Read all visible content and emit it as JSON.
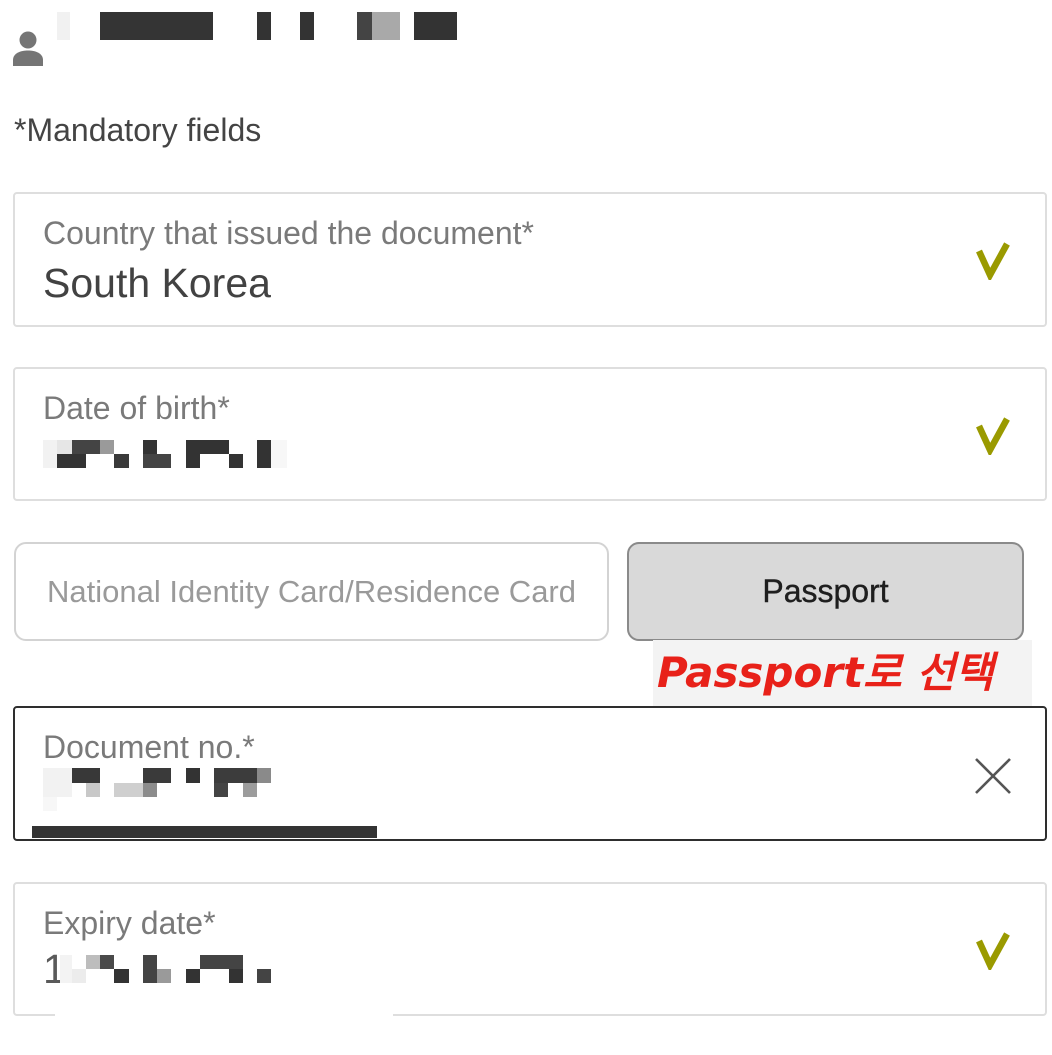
{
  "header": {
    "avatar_icon": "person-icon"
  },
  "form": {
    "mandatory_note": "*Mandatory fields",
    "country": {
      "label": "Country that issued the document*",
      "value": "South Korea",
      "status_icon": "checkmark-icon"
    },
    "date_of_birth": {
      "label": "Date of birth*",
      "status_icon": "checkmark-icon"
    },
    "document_type": {
      "options": [
        {
          "label": "National Identity Card/Residence Card",
          "selected": false
        },
        {
          "label": "Passport",
          "selected": true
        }
      ]
    },
    "document_number": {
      "label": "Document no.*",
      "clear_icon": "close-icon"
    },
    "expiry_date": {
      "label": "Expiry date*",
      "value": "1",
      "status_icon": "checkmark-icon"
    }
  },
  "annotation": {
    "text": "Passport로 선택"
  },
  "colors": {
    "check": "#9a9a00",
    "active_border": "#2e2e2e",
    "selected_option_bg": "#d9d9d9",
    "annotation_text": "#e82119"
  }
}
